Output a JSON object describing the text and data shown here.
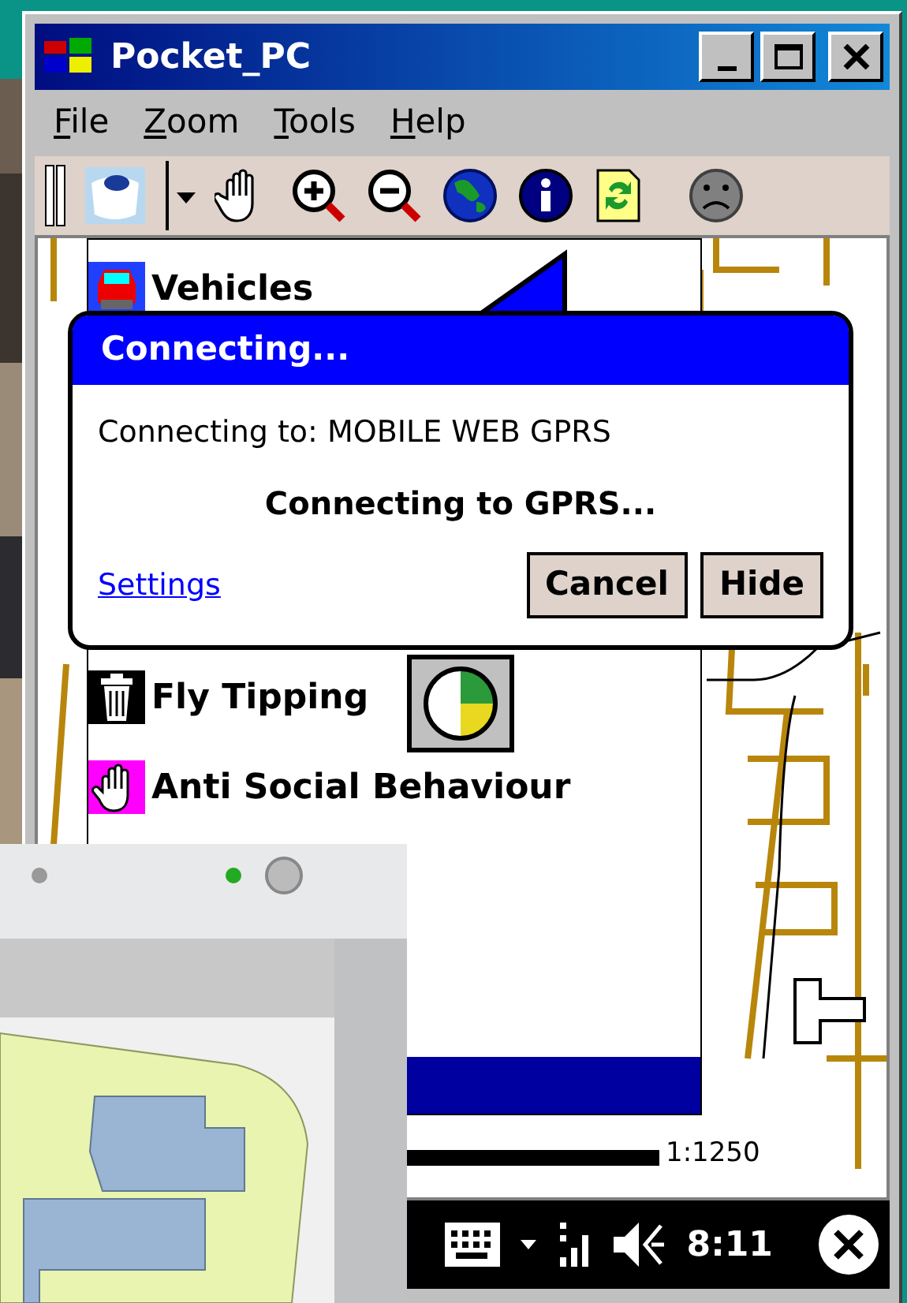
{
  "window": {
    "title": "Pocket_PC"
  },
  "menu": [
    {
      "label": "File"
    },
    {
      "label": "Zoom"
    },
    {
      "label": "Tools"
    },
    {
      "label": "Help"
    }
  ],
  "layers": [
    {
      "kind": "car",
      "label": "Vehicles"
    },
    {
      "kind": "bin",
      "label": "Fly Tipping"
    },
    {
      "kind": "hand",
      "label": "Anti Social Behaviour"
    }
  ],
  "dialog": {
    "title": "Connecting...",
    "target": "Connecting to: MOBILE WEB GPRS",
    "status": "Connecting to GPRS...",
    "link": "Settings",
    "buttons": [
      "Cancel",
      "Hide"
    ]
  },
  "scale": "1:1250",
  "taskbar": {
    "time": "8:11"
  }
}
